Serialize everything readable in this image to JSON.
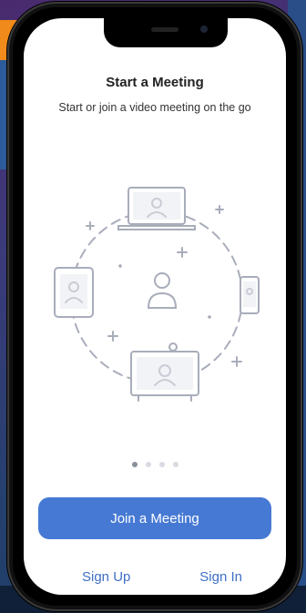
{
  "onboarding": {
    "title": "Start a Meeting",
    "subtitle": "Start or join a video meeting on the go",
    "page_indicator": {
      "count": 4,
      "active_index": 0
    }
  },
  "actions": {
    "join_label": "Join a Meeting",
    "signup_label": "Sign Up",
    "signin_label": "Sign In"
  },
  "colors": {
    "primary": "#4679d3",
    "link": "#3f6fc6",
    "illustration": "#a8adba"
  }
}
